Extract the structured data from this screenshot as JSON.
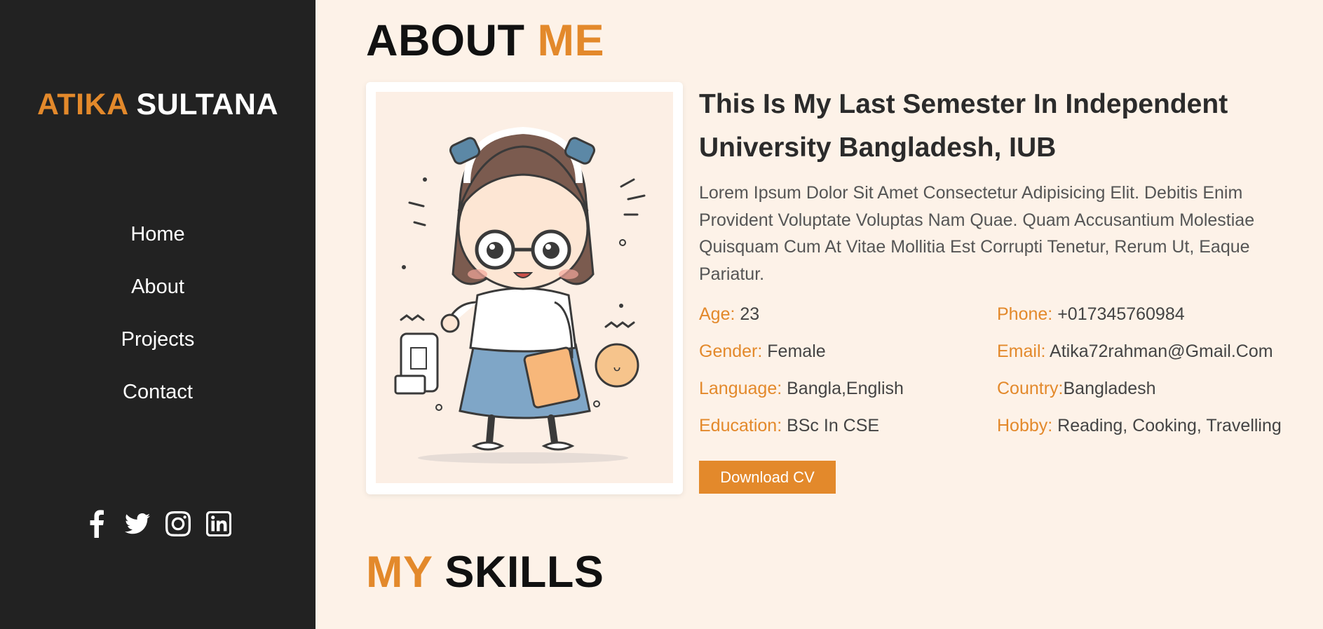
{
  "brand": {
    "first": "ATIKA",
    "last": "SULTANA"
  },
  "nav": [
    {
      "label": "Home"
    },
    {
      "label": "About"
    },
    {
      "label": "Projects"
    },
    {
      "label": "Contact"
    }
  ],
  "socials": [
    {
      "icon": "facebook-icon"
    },
    {
      "icon": "twitter-icon"
    },
    {
      "icon": "instagram-icon"
    },
    {
      "icon": "linkedin-icon"
    }
  ],
  "about": {
    "title_main": "ABOUT",
    "title_accent": "ME",
    "headline": "This Is My Last Semester In Independent University Bangladesh, IUB",
    "description": "Lorem Ipsum Dolor Sit Amet Consectetur Adipisicing Elit. Debitis Enim Provident Voluptate Voluptas Nam Quae. Quam Accusantium Molestiae Quisquam Cum At Vitae Mollitia Est Corrupti Tenetur, Rerum Ut, Eaque Pariatur.",
    "info": [
      {
        "label": "Age:",
        "value": " 23"
      },
      {
        "label": "Phone:",
        "value": " +017345760984"
      },
      {
        "label": "Gender:",
        "value": " Female"
      },
      {
        "label": "Email:",
        "value": " Atika72rahman@Gmail.Com"
      },
      {
        "label": "Language:",
        "value": " Bangla,English"
      },
      {
        "label": "Country:",
        "value": "Bangladesh"
      },
      {
        "label": "Education:",
        "value": " BSc In CSE"
      },
      {
        "label": "Hobby:",
        "value": " Reading, Cooking, Travelling"
      }
    ],
    "button": "Download CV"
  },
  "skills": {
    "title_accent": "MY",
    "title_main": "SKILLS"
  },
  "colors": {
    "accent": "#e3892b",
    "sidebar": "#222222",
    "background": "#fdf2e8"
  }
}
